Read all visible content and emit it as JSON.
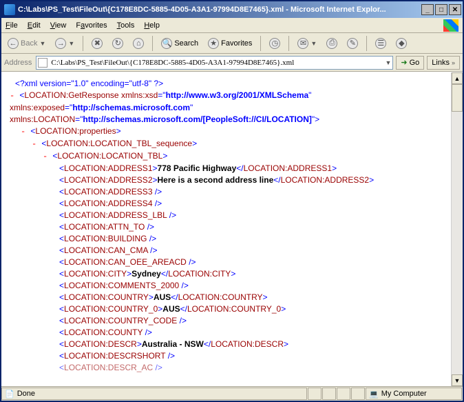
{
  "window": {
    "title": "C:\\Labs\\PS_Test\\FileOut\\{C178E8DC-5885-4D05-A3A1-97994D8E7465}.xml - Microsoft Internet Explor..."
  },
  "menu": {
    "file": "File",
    "edit": "Edit",
    "view": "View",
    "favorites": "Favorites",
    "tools": "Tools",
    "help": "Help"
  },
  "toolbar": {
    "back": "Back",
    "search": "Search",
    "favorites": "Favorites"
  },
  "address": {
    "label": "Address",
    "value": "C:\\Labs\\PS_Test\\FileOut\\{C178E8DC-5885-4D05-A3A1-97994D8E7465}.xml",
    "go": "Go",
    "links": "Links"
  },
  "xml": {
    "decl": "<?xml version=\"1.0\" encoding=\"utf-8\" ?>",
    "root": "LOCATION:GetResponse",
    "ns_xsd_name": "xmlns:xsd",
    "ns_xsd_val": "http://www.w3.org/2001/XMLSchema",
    "ns_exp_name": "xmlns:exposed",
    "ns_exp_val": "http://schemas.microsoft.com",
    "ns_loc_name": "xmlns:LOCATION",
    "ns_loc_val": "http://schemas.microsoft.com/[PeopleSoft://CI/LOCATION]",
    "props": "LOCATION:properties",
    "seq": "LOCATION:LOCATION_TBL_sequence",
    "tbl": "LOCATION:LOCATION_TBL",
    "addr1": {
      "tag": "LOCATION:ADDRESS1",
      "val": "778 Pacific Highway"
    },
    "addr2": {
      "tag": "LOCATION:ADDRESS2",
      "val": "Here is a second address line"
    },
    "addr3": "LOCATION:ADDRESS3",
    "addr4": "LOCATION:ADDRESS4",
    "addrlbl": "LOCATION:ADDRESS_LBL",
    "attn": "LOCATION:ATTN_TO",
    "bldg": "LOCATION:BUILDING",
    "cancma": "LOCATION:CAN_CMA",
    "canoee": "LOCATION:CAN_OEE_AREACD",
    "city": {
      "tag": "LOCATION:CITY",
      "val": "Sydney"
    },
    "comments": "LOCATION:COMMENTS_2000",
    "country": {
      "tag": "LOCATION:COUNTRY",
      "val": "AUS"
    },
    "country0": {
      "tag": "LOCATION:COUNTRY_0",
      "val": "AUS"
    },
    "countrycode": "LOCATION:COUNTRY_CODE",
    "county": "LOCATION:COUNTY",
    "descr": {
      "tag": "LOCATION:DESCR",
      "val": "Australia - NSW"
    },
    "descrshort": "LOCATION:DESCRSHORT",
    "descrac": "LOCATION:DESCR_AC"
  },
  "status": {
    "done": "Done",
    "zone": "My Computer"
  }
}
